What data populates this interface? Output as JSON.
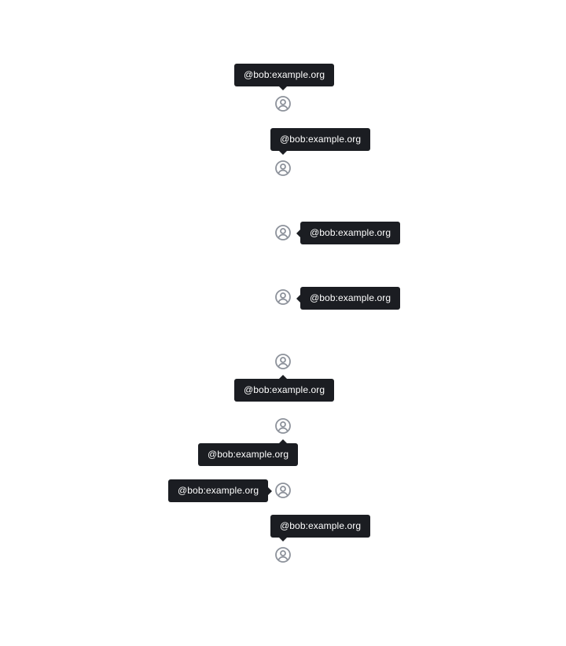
{
  "colors": {
    "tooltip_bg": "#1b1d22",
    "tooltip_text": "#ffffff",
    "avatar_icon": "#8d929b",
    "background": "#ffffff"
  },
  "avatar_icon": "user-circle-icon",
  "tooltips": [
    {
      "text": "@bob:example.org",
      "placement": "top-center"
    },
    {
      "text": "@bob:example.org",
      "placement": "top-start"
    },
    {
      "text": "@bob:example.org",
      "placement": "right"
    },
    {
      "text": "@bob:example.org",
      "placement": "right"
    },
    {
      "text": "@bob:example.org",
      "placement": "bottom-center"
    },
    {
      "text": "@bob:example.org",
      "placement": "bottom-end"
    },
    {
      "text": "@bob:example.org",
      "placement": "left"
    },
    {
      "text": "@bob:example.org",
      "placement": "top-start"
    }
  ]
}
